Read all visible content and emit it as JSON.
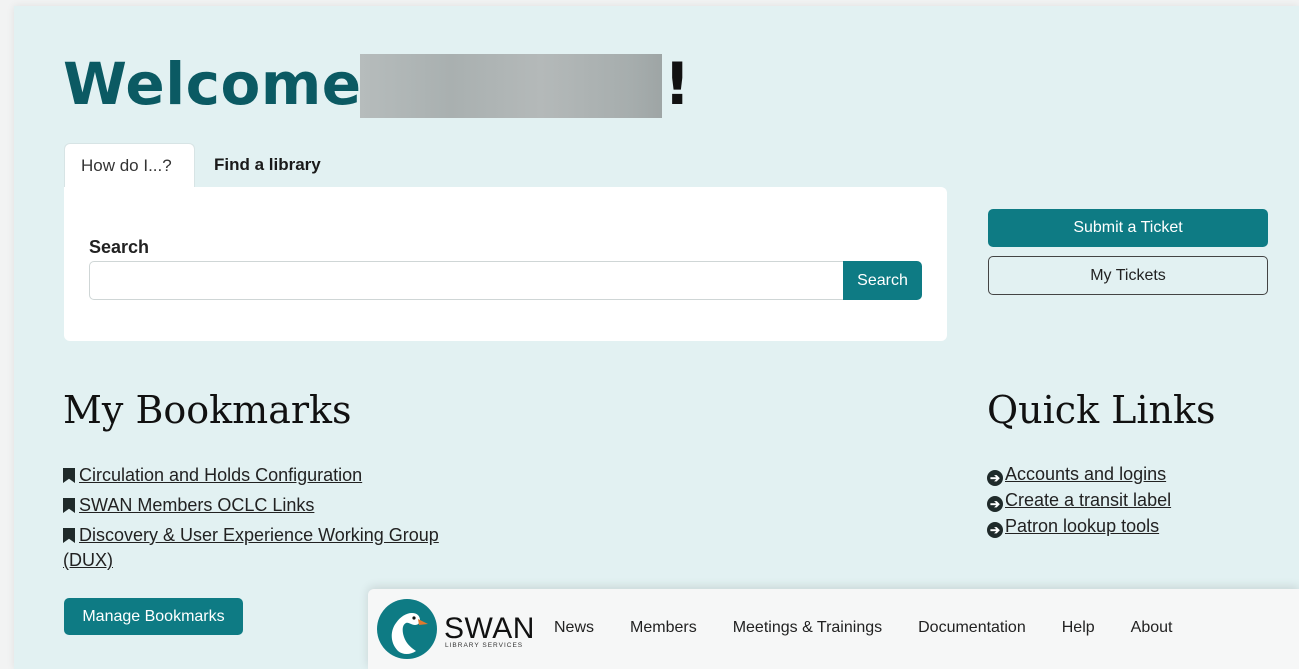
{
  "welcome": {
    "prefix": "Welcome,",
    "suffix": "!"
  },
  "tabs": [
    {
      "label": "How do I...?"
    },
    {
      "label": "Find a library"
    }
  ],
  "search": {
    "label": "Search",
    "placeholder": "",
    "value": "",
    "button_label": "Search"
  },
  "tickets": {
    "submit_label": "Submit a Ticket",
    "my_label": "My Tickets"
  },
  "bookmarks": {
    "title": "My Bookmarks",
    "items": [
      {
        "label": "Circulation and Holds Configuration"
      },
      {
        "label": "SWAN Members OCLC Links"
      },
      {
        "label": "Discovery & User Experience Working Group (DUX)"
      }
    ],
    "manage_label": "Manage Bookmarks"
  },
  "quick_links": {
    "title": "Quick Links",
    "items": [
      {
        "label": "Accounts and logins"
      },
      {
        "label": "Create a transit label"
      },
      {
        "label": "Patron lookup tools"
      }
    ]
  },
  "navbar": {
    "logo_text": "SWAN",
    "logo_sub": "LIBRARY SERVICES",
    "items": [
      "News",
      "Members",
      "Meetings & Trainings",
      "Documentation",
      "Help",
      "About"
    ]
  },
  "colors": {
    "accent": "#0e7b84",
    "heading": "#0b5a63",
    "hero_bg": "#e2f1f2"
  },
  "icons": {
    "bookmark": "bookmark-icon",
    "quick_link": "circle-arrow-right-icon"
  }
}
